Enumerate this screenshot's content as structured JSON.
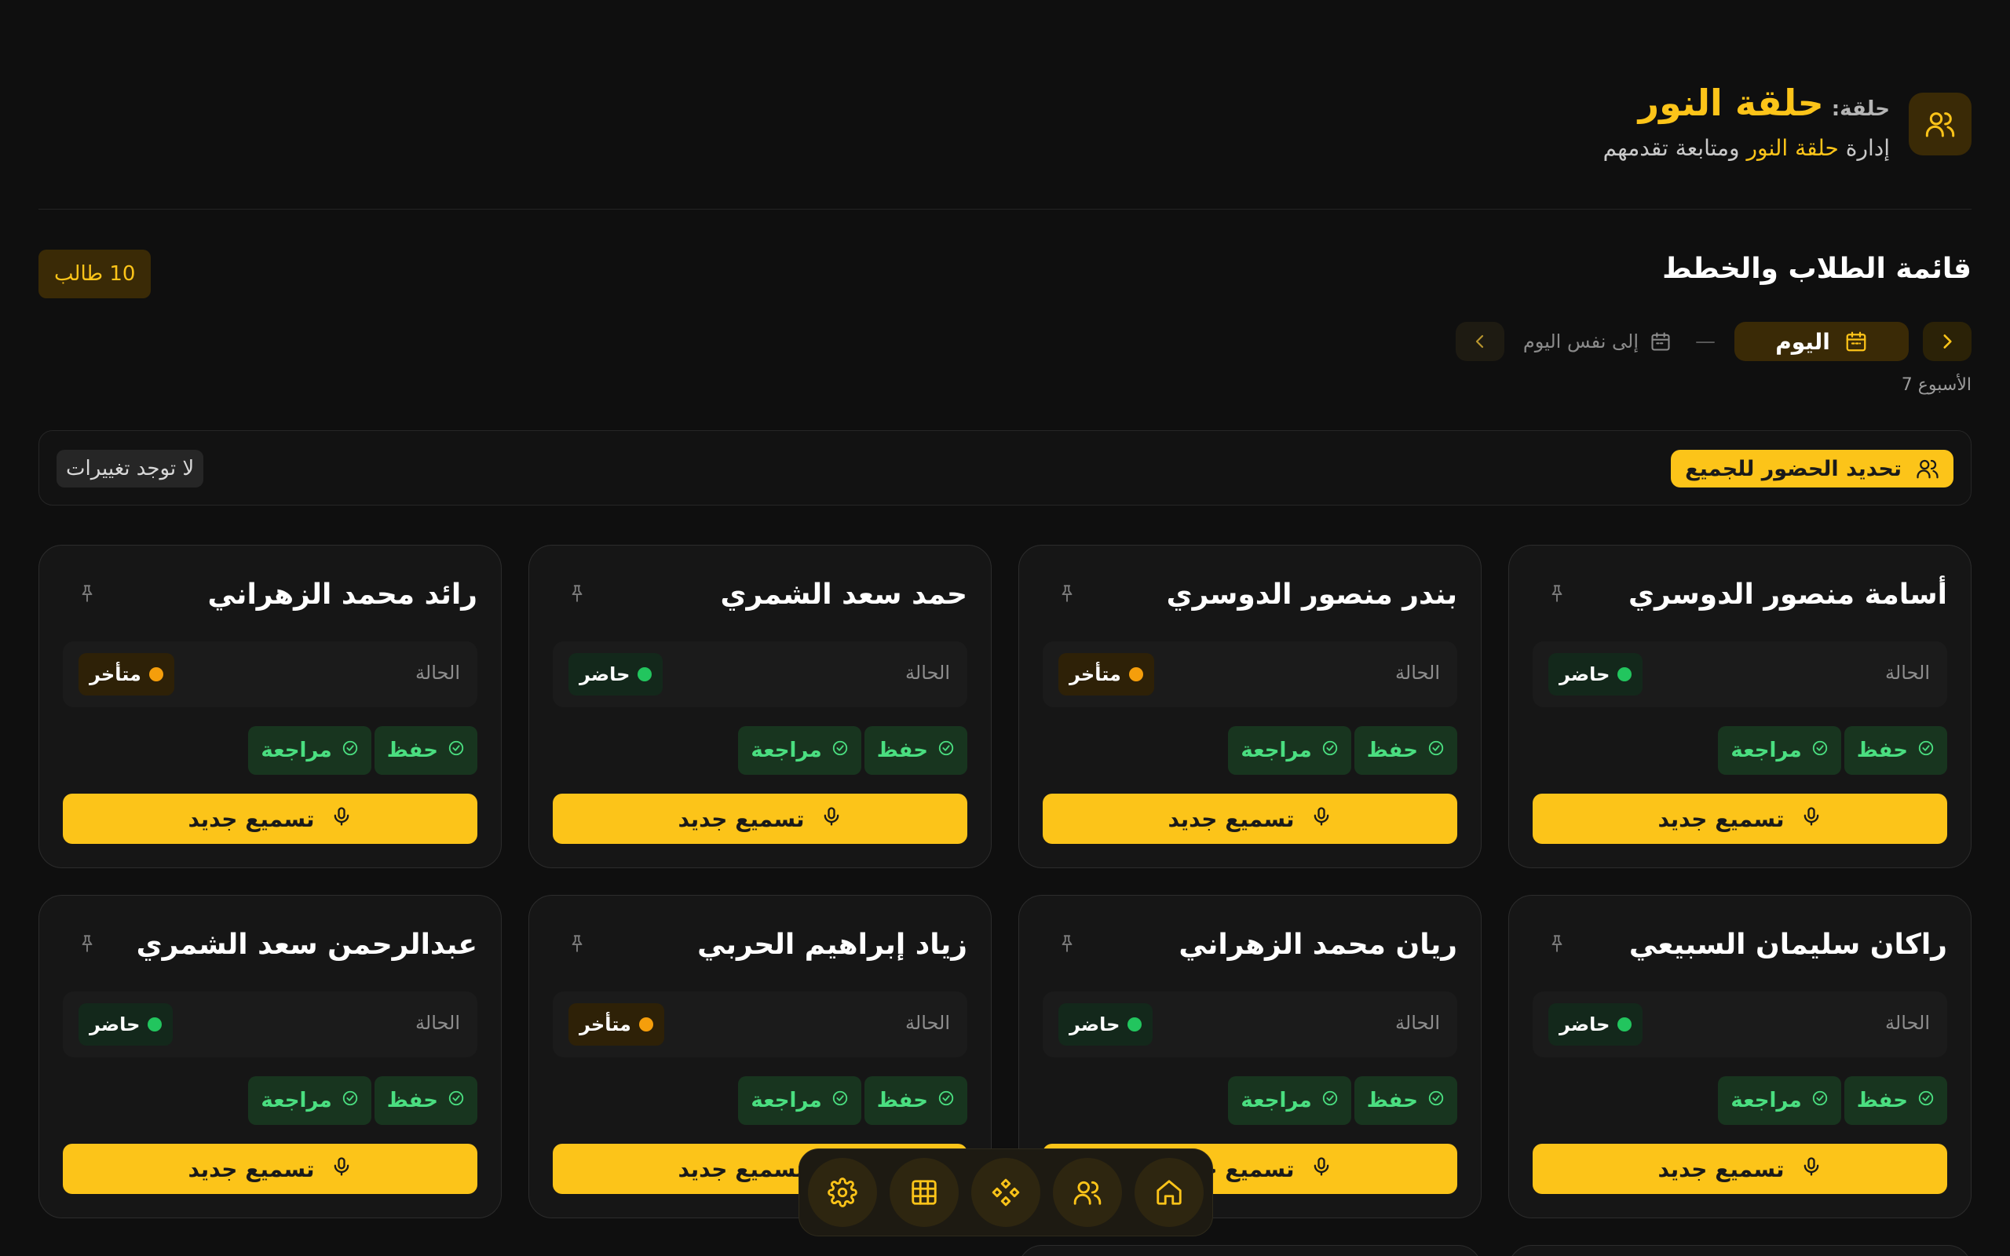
{
  "header": {
    "title_prefix": "حلقة:",
    "circle_name": "حلقة النور",
    "subtitle_before": "إدارة ",
    "subtitle_highlight": "حلقة النور",
    "subtitle_after": " ومتابعة تقدمهم",
    "icon": "users-icon"
  },
  "section": {
    "title": "قائمة الطلاب والخطط",
    "count_badge": "10 طالب"
  },
  "date_nav": {
    "from_label": "اليوم",
    "separator": "—",
    "to_label": "إلى نفس اليوم",
    "week_label": "الأسبوع 7"
  },
  "actions": {
    "bulk_attendance": "تحديد الحضور للجميع",
    "no_changes": "لا توجد تغييرات"
  },
  "labels": {
    "status": "الحالة",
    "present": "حاضر",
    "late": "متأخر",
    "memorize": "حفظ",
    "review": "مراجعة",
    "new_recitation": "تسميع جديد"
  },
  "students": [
    {
      "name": "أسامة منصور الدوسري",
      "status": "حاضر",
      "status_type": "present"
    },
    {
      "name": "بندر منصور الدوسري",
      "status": "متأخر",
      "status_type": "late"
    },
    {
      "name": "حمد سعد الشمري",
      "status": "حاضر",
      "status_type": "present"
    },
    {
      "name": "رائد محمد الزهراني",
      "status": "متأخر",
      "status_type": "late"
    },
    {
      "name": "راكان سليمان السبيعي",
      "status": "حاضر",
      "status_type": "present"
    },
    {
      "name": "ريان محمد الزهراني",
      "status": "حاضر",
      "status_type": "present"
    },
    {
      "name": "زياد إبراهيم الحربي",
      "status": "متأخر",
      "status_type": "late"
    },
    {
      "name": "عبدالرحمن سعد الشمري",
      "status": "حاضر",
      "status_type": "present"
    }
  ],
  "dock": [
    "settings-icon",
    "grid-icon",
    "apps-icon",
    "users-icon",
    "home-icon"
  ],
  "colors": {
    "accent": "#fcc419",
    "background": "#0f0f0f",
    "present": "#22c55e",
    "late": "#f59e0b",
    "tag_text": "#4ade80"
  }
}
